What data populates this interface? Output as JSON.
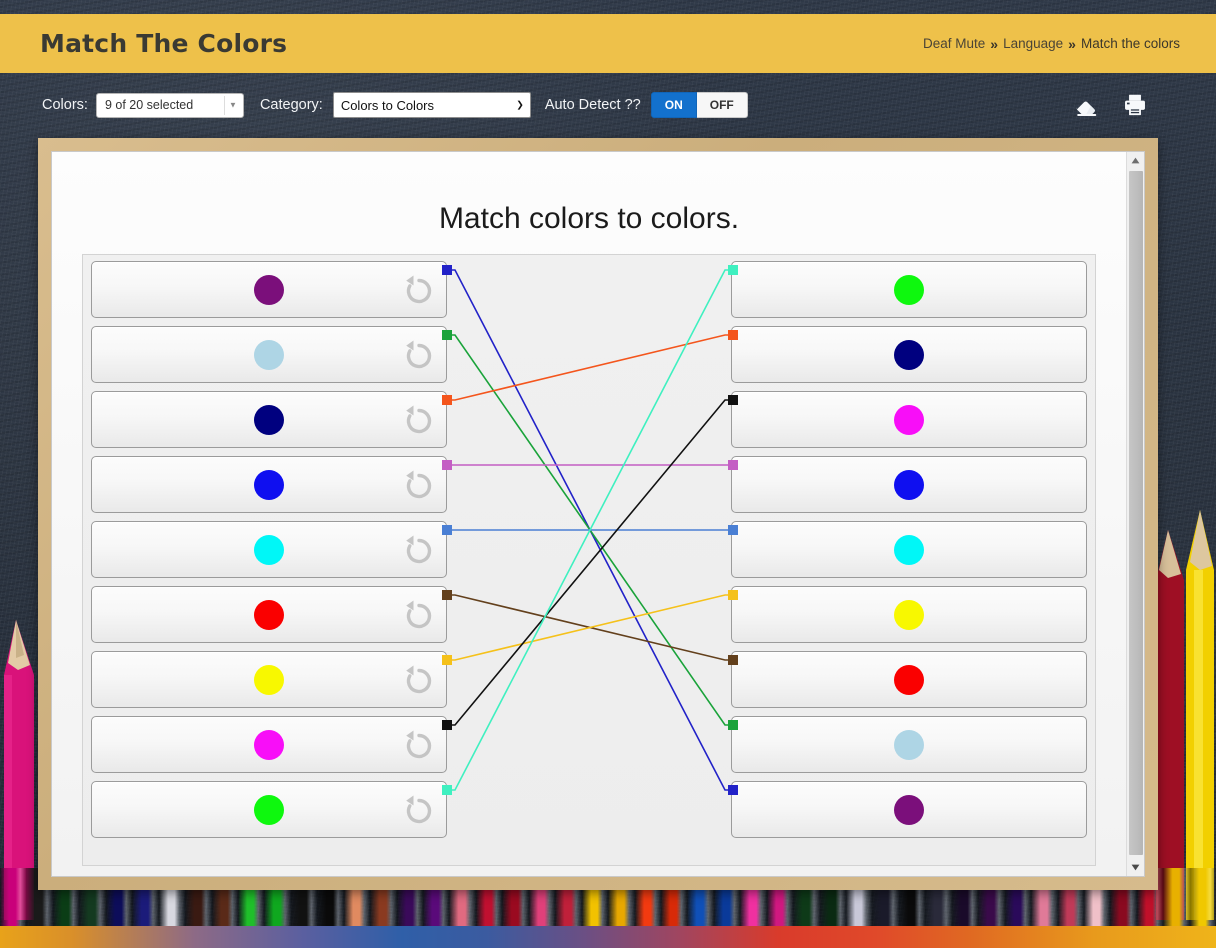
{
  "header": {
    "title": "Match The Colors",
    "breadcrumb": [
      {
        "label": "Deaf Mute",
        "link": true
      },
      {
        "label": "»",
        "sep": true
      },
      {
        "label": "Language",
        "link": true
      },
      {
        "label": "»",
        "sep": true
      },
      {
        "label": "Match the colors",
        "link": false
      }
    ]
  },
  "toolbar": {
    "colors_label": "Colors:",
    "colors_value": "9 of 20 selected",
    "category_label": "Category:",
    "category_value": "Colors to Colors",
    "autodetect_label": "Auto Detect ??",
    "on_label": "ON",
    "off_label": "OFF",
    "eraser_icon": "eraser-icon",
    "print_icon": "print-icon"
  },
  "board": {
    "title": "Match colors to colors.",
    "left_column": [
      {
        "index": 0,
        "color": "#7b0f7b",
        "name": "purple",
        "undo_icon": "undo-icon"
      },
      {
        "index": 1,
        "color": "#aed5e5",
        "name": "lightblue",
        "undo_icon": "undo-icon"
      },
      {
        "index": 2,
        "color": "#00007f",
        "name": "navy",
        "undo_icon": "undo-icon"
      },
      {
        "index": 3,
        "color": "#0f0ff0",
        "name": "blue",
        "undo_icon": "undo-icon"
      },
      {
        "index": 4,
        "color": "#00f7f7",
        "name": "cyan",
        "undo_icon": "undo-icon"
      },
      {
        "index": 5,
        "color": "#fa0000",
        "name": "red",
        "undo_icon": "undo-icon"
      },
      {
        "index": 6,
        "color": "#f8f800",
        "name": "yellow",
        "undo_icon": "undo-icon"
      },
      {
        "index": 7,
        "color": "#f80ef8",
        "name": "magenta",
        "undo_icon": "undo-icon"
      },
      {
        "index": 8,
        "color": "#0ef80e",
        "name": "green",
        "undo_icon": "undo-icon"
      }
    ],
    "right_column": [
      {
        "index": 0,
        "color": "#0ef80e",
        "name": "green"
      },
      {
        "index": 1,
        "color": "#00007f",
        "name": "navy"
      },
      {
        "index": 2,
        "color": "#f80ef8",
        "name": "magenta"
      },
      {
        "index": 3,
        "color": "#0f0ff0",
        "name": "blue"
      },
      {
        "index": 4,
        "color": "#00f7f7",
        "name": "cyan"
      },
      {
        "index": 5,
        "color": "#f8f800",
        "name": "yellow"
      },
      {
        "index": 6,
        "color": "#fa0000",
        "name": "red"
      },
      {
        "index": 7,
        "color": "#aed5e5",
        "name": "lightblue"
      },
      {
        "index": 8,
        "color": "#7b0f7b",
        "name": "purple"
      }
    ],
    "connections": [
      {
        "from": 0,
        "to": 8,
        "color": "#2222c8"
      },
      {
        "from": 1,
        "to": 7,
        "color": "#1aa33a"
      },
      {
        "from": 2,
        "to": 1,
        "color": "#f4551c"
      },
      {
        "from": 3,
        "to": 3,
        "color": "#c45ec4"
      },
      {
        "from": 4,
        "to": 4,
        "color": "#4a7fd4"
      },
      {
        "from": 5,
        "to": 6,
        "color": "#63401c"
      },
      {
        "from": 6,
        "to": 5,
        "color": "#f5c11a"
      },
      {
        "from": 7,
        "to": 2,
        "color": "#111111"
      },
      {
        "from": 8,
        "to": 0,
        "color": "#3ff0c0"
      }
    ]
  },
  "scrollbar": {
    "up_icon": "caret-up-icon",
    "down_icon": "caret-down-icon",
    "thumb": "scroll-thumb"
  },
  "colors": {
    "header_bg": "#eec14a",
    "board_frame": "#d2b384",
    "accent_blue": "#1371cd",
    "backdrop": "#2b3543"
  },
  "pencil_strip": [
    "#c9007a",
    "#1a1a1a",
    "#0b3d16",
    "#143a20",
    "#0d0d5a",
    "#1b1b7a",
    "#d8d8e0",
    "#3a1a12",
    "#5a2a18",
    "#1fbf2a",
    "#0fa81f",
    "#111111",
    "#0a0a0a",
    "#e08a60",
    "#8a3a20",
    "#3a0a5a",
    "#5a0a7a",
    "#e06a80",
    "#c01030",
    "#9a0a20",
    "#e0407a",
    "#c0203a",
    "#f2c200",
    "#e8a800",
    "#f23a10",
    "#d82a08",
    "#1050b8",
    "#0a3a9a",
    "#f030a0",
    "#d01880",
    "#0e3a18",
    "#0a2a12",
    "#c8c8d8",
    "#1a1a2a",
    "#0a0a0a",
    "#2a2a3a",
    "#1a0a2a",
    "#3a0a4a",
    "#2a0a5a",
    "#e07a98",
    "#c03a58",
    "#f0c0c8",
    "#8a0a20",
    "#c0102a",
    "#e8b000",
    "#f0c800"
  ]
}
